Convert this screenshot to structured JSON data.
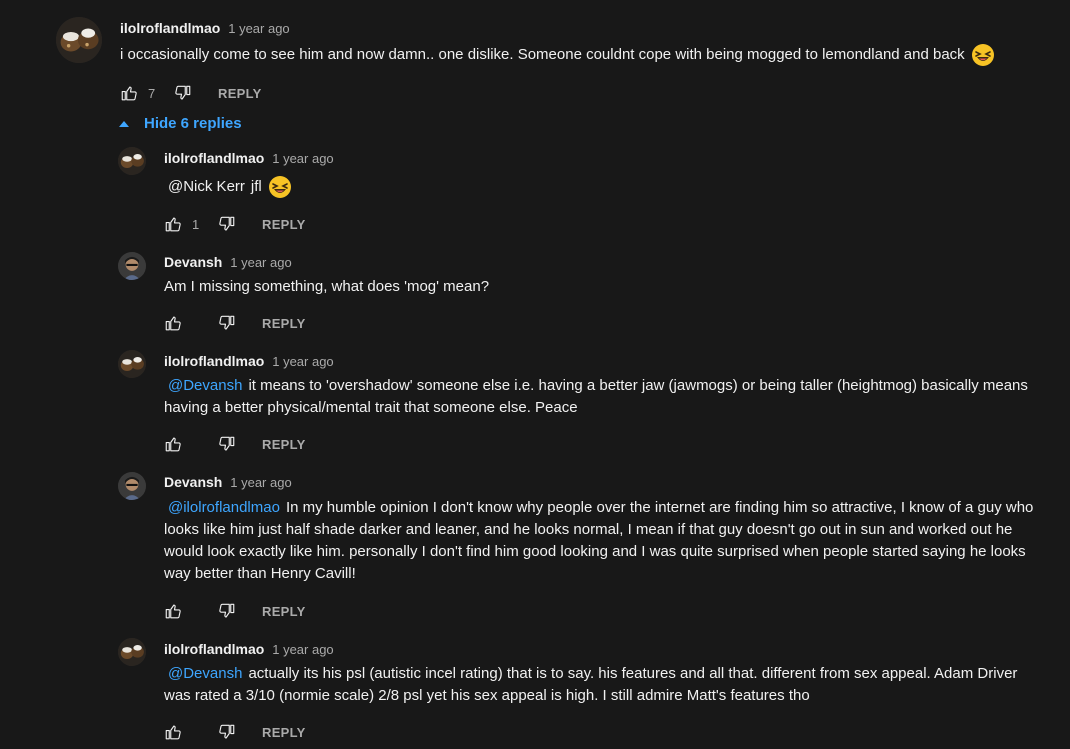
{
  "top_comment": {
    "author": "ilolroflandlmao",
    "time": "1 year ago",
    "text": "i occasionally come to see him and now damn.. one dislike. Someone couldnt cope with being mogged to lemondland and back",
    "emoji": "laughing-emoji",
    "likes": "7",
    "reply_label": "REPLY"
  },
  "hide_replies_label": "Hide 6 replies",
  "replies": [
    {
      "author": "ilolroflandlmao",
      "time": "1 year ago",
      "mention": "@Nick Kerr",
      "text": "jfl",
      "emoji": "laughing-emoji",
      "likes": "1",
      "reply_label": "REPLY"
    },
    {
      "author": "Devansh",
      "time": "1 year ago",
      "mention": "",
      "text": "Am I missing something, what does 'mog' mean?",
      "likes": "",
      "reply_label": "REPLY"
    },
    {
      "author": "ilolroflandlmao",
      "time": "1 year ago",
      "mention": "@Devansh",
      "text": "it means to 'overshadow' someone else i.e. having a better jaw (jawmogs) or being taller (heightmog) basically means having a better physical/mental trait that someone else. Peace",
      "likes": "",
      "reply_label": "REPLY"
    },
    {
      "author": "Devansh",
      "time": "1 year ago",
      "mention": "@ilolroflandlmao",
      "text": "In my humble opinion I don't know why people over the internet are finding him so attractive, I know of a guy who looks like him just half shade darker and leaner, and he looks normal, I mean if that guy doesn't go out in sun and worked out he would look exactly like him. personally I don't find him good looking and I was quite surprised when people started saying he looks way better than Henry Cavill!",
      "likes": "",
      "reply_label": "REPLY"
    },
    {
      "author": "ilolroflandlmao",
      "time": "1 year ago",
      "mention": "@Devansh",
      "text": "actually its his psl (autistic incel rating) that is to say. his features and all that. different from sex appeal. Adam Driver was rated a 3/10 (normie scale) 2/8 psl yet his sex appeal is high. I still admire Matt's features tho",
      "likes": "",
      "reply_label": "REPLY"
    }
  ],
  "colors": {
    "background": "#181818",
    "text": "#f1f1f1",
    "secondary": "#aaaaaa",
    "link": "#3ea6ff"
  }
}
